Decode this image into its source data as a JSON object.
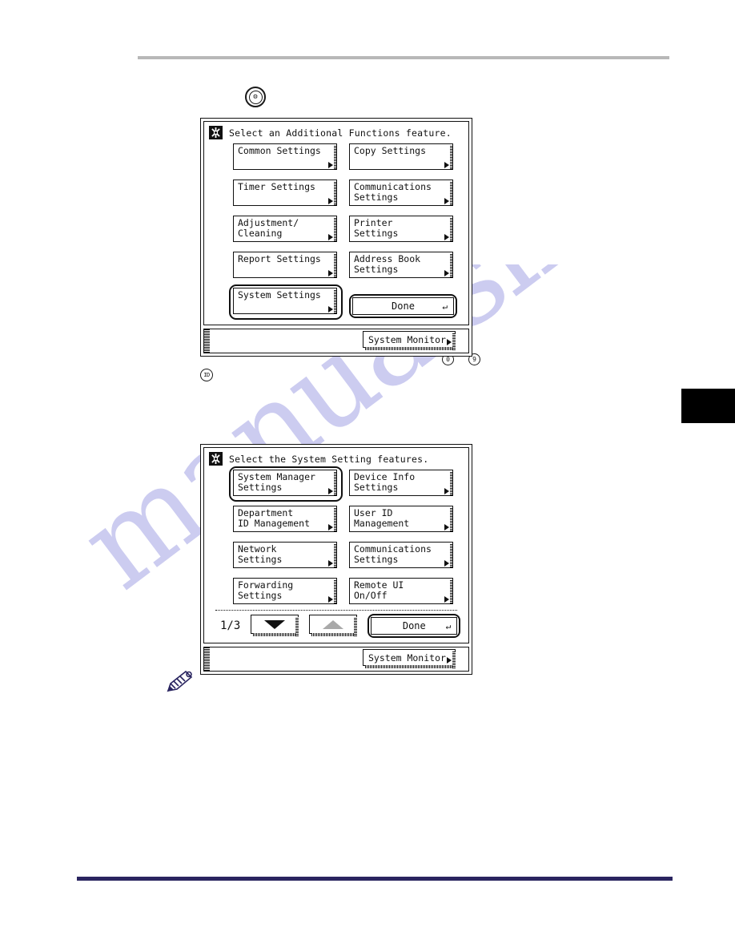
{
  "page": {
    "watermark_text": "manualslive.com",
    "top_rule_color": "#b8b8b8",
    "bottom_rule_color": "#2a2560",
    "edge_tab_color": "#000000"
  },
  "keys": {
    "additional_functions": {
      "name": "additional-functions-key",
      "glyph": "⚙"
    },
    "id_key": {
      "label": "ID"
    },
    "numeric_0": {
      "label": "0"
    },
    "numeric_9": {
      "label": "9"
    }
  },
  "note_marker": {
    "name": "note-pencil-icon",
    "color": "#2a2560"
  },
  "panel1": {
    "title": "Select an Additional Functions feature.",
    "buttons": [
      {
        "line1": "Common Settings",
        "line2": "",
        "selected": false
      },
      {
        "line1": "Copy Settings",
        "line2": "",
        "selected": false
      },
      {
        "line1": "Timer Settings",
        "line2": "",
        "selected": false
      },
      {
        "line1": "Communications",
        "line2": "Settings",
        "selected": false
      },
      {
        "line1": "Adjustment/",
        "line2": "Cleaning",
        "selected": false
      },
      {
        "line1": "Printer Settings",
        "line2": "",
        "selected": false
      },
      {
        "line1": "Report Settings",
        "line2": "",
        "selected": false
      },
      {
        "line1": "Address Book",
        "line2": "Settings",
        "selected": false
      },
      {
        "line1": "System Settings",
        "line2": "",
        "selected": true
      }
    ],
    "done_label": "Done",
    "done_return_glyph": "↵",
    "system_monitor_label": "System Monitor"
  },
  "panel2": {
    "title": "Select the System Setting features.",
    "buttons": [
      {
        "line1": "System Manager",
        "line2": "Settings",
        "selected": true
      },
      {
        "line1": "Device Info",
        "line2": "Settings",
        "selected": false
      },
      {
        "line1": "Department",
        "line2": "ID Management",
        "selected": false
      },
      {
        "line1": "User ID",
        "line2": "Management",
        "selected": false
      },
      {
        "line1": "Network",
        "line2": "Settings",
        "selected": false
      },
      {
        "line1": "Communications",
        "line2": "Settings",
        "selected": false
      },
      {
        "line1": "Forwarding",
        "line2": "Settings",
        "selected": false
      },
      {
        "line1": "Remote UI",
        "line2": "On/Off",
        "selected": false
      }
    ],
    "page_indicator": "1/3",
    "scroll_down_label": "scroll-down",
    "scroll_up_label": "scroll-up",
    "done_label": "Done",
    "done_return_glyph": "↵",
    "system_monitor_label": "System Monitor"
  }
}
